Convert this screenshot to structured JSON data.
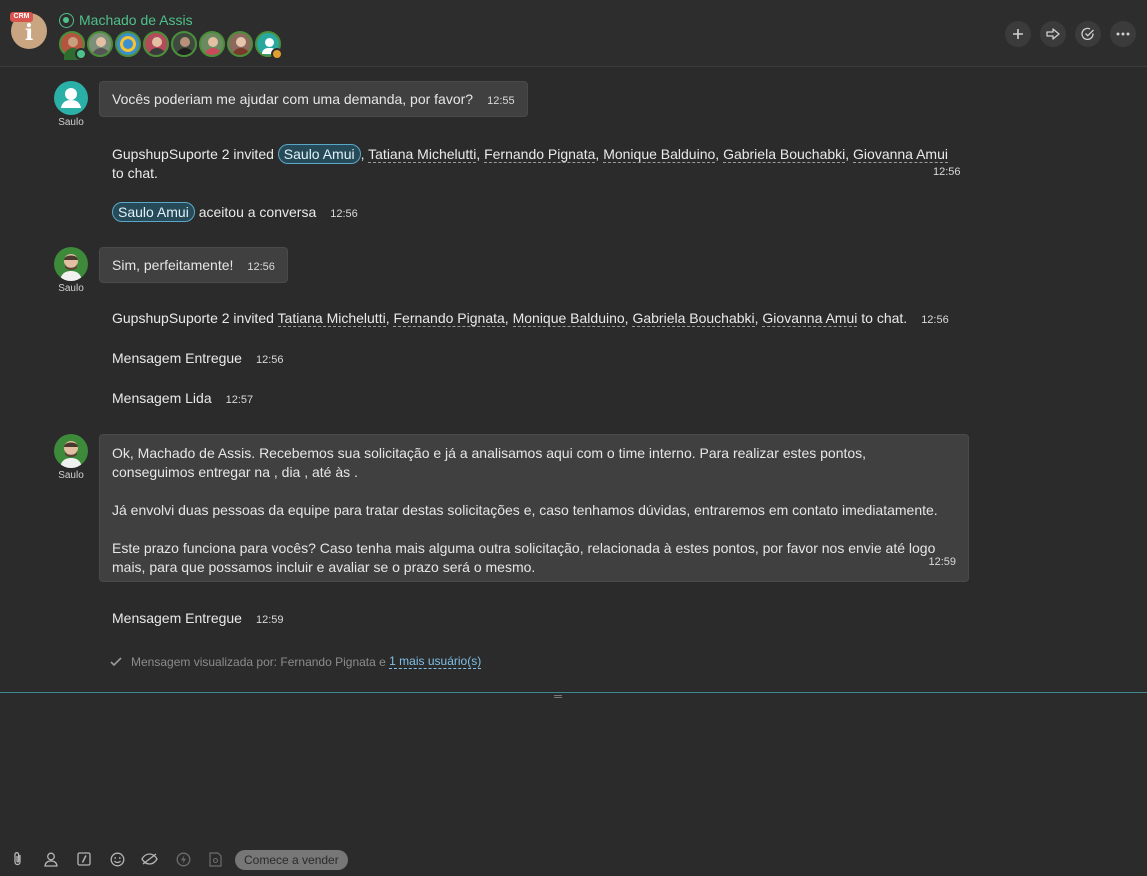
{
  "header": {
    "crm_badge": "CRM",
    "crm_logo_letter": "i",
    "contact_name": "Machado de Assis",
    "participants": [
      "participant-1",
      "participant-2",
      "participant-3",
      "participant-4",
      "participant-5",
      "participant-6",
      "participant-7",
      "participant-8"
    ],
    "actions": [
      "plus-icon",
      "forward-icon",
      "check-circle-icon",
      "more-icon"
    ]
  },
  "messages": {
    "m1": {
      "author": "Saulo",
      "text": "Vocês poderiam me ajudar com uma demanda, por favor?",
      "time": "12:55"
    },
    "s1": {
      "actor": "GupshupSuporte 2 invited",
      "pill": "Saulo Amui",
      "names": [
        "Tatiana Michelutti",
        "Fernando Pignata",
        "Monique Balduino",
        "Gabriela Bouchabki",
        "Giovanna Amui"
      ],
      "tail": "to chat.",
      "time": "12:56"
    },
    "s2": {
      "pill": "Saulo Amui",
      "text": "aceitou a conversa",
      "time": "12:56"
    },
    "m2": {
      "author": "Saulo",
      "text": "Sim, perfeitamente!",
      "time": "12:56"
    },
    "s3": {
      "actor": "GupshupSuporte 2 invited",
      "names": [
        "Tatiana Michelutti",
        "Fernando Pignata",
        "Monique Balduino",
        "Gabriela Bouchabki",
        "Giovanna Amui"
      ],
      "tail": "to chat.",
      "time": "12:56"
    },
    "s4": {
      "text": "Mensagem Entregue",
      "time": "12:56"
    },
    "s5": {
      "text": "Mensagem Lida",
      "time": "12:57"
    },
    "m3": {
      "author": "Saulo",
      "p1a": "Ok, Machado de Assis. Recebemos sua solicitação e já a analisamos aqui com o time interno. Para realizar estes pontos,",
      "p1b": "conseguimos entregar na , dia , até às .",
      "p2": "Já envolvi duas pessoas da equipe para tratar destas solicitações e, caso tenhamos dúvidas, entraremos em contato imediatamente.",
      "p3a": "Este prazo funciona para vocês? Caso tenha mais alguma outra solicitação, relacionada à estes pontos, por favor nos envie até logo",
      "p3b": "mais, para que possamos incluir e avaliar se o prazo será o mesmo.",
      "time": "12:59"
    },
    "s6": {
      "text": "Mensagem Entregue",
      "time": "12:59"
    },
    "viewed": {
      "prefix": "Mensagem visualizada por: Fernando Pignata e",
      "more": "1 mais usuário(s)"
    }
  },
  "composer": {
    "tools": [
      "paperclip-icon",
      "person-icon",
      "slash-command-icon",
      "emoji-icon",
      "hide-icon",
      "lightning-icon",
      "template-icon"
    ],
    "sell_button": "Comece a vender"
  }
}
